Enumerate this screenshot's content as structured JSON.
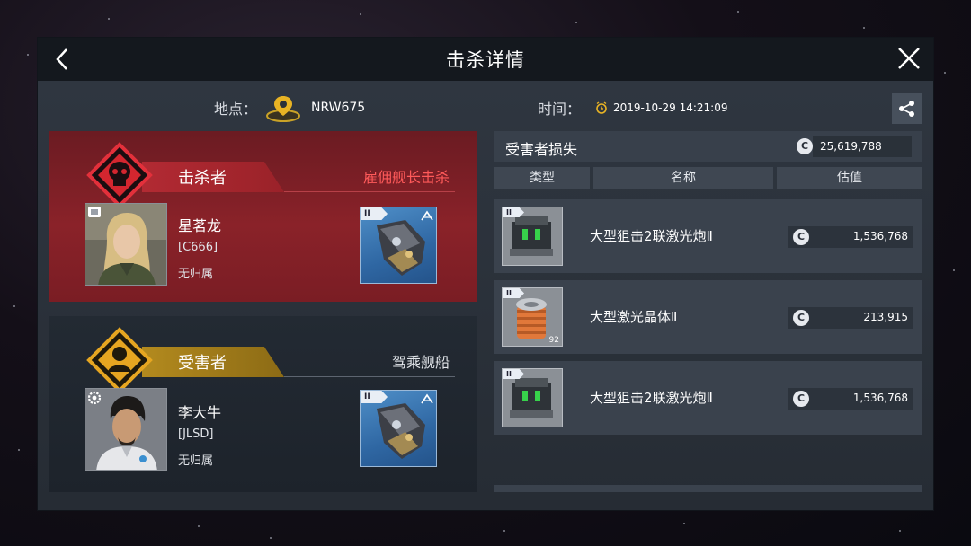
{
  "window": {
    "title": "击杀详情"
  },
  "info": {
    "location_label": "地点：",
    "location_value": "NRW675",
    "time_label": "时间：",
    "time_value": "2019-10-29 14:21:09"
  },
  "killer": {
    "role_label": "击杀者",
    "note": "雇佣舰长击杀",
    "name": "星茗龙",
    "corp": "[C666]",
    "alignment": "无归属",
    "ship_tier": "II"
  },
  "victim": {
    "role_label": "受害者",
    "note": "驾乘舰船",
    "name": "李大牛",
    "corp": "[JLSD]",
    "alignment": "无归属",
    "ship_tier": "II"
  },
  "loss": {
    "title": "受害者损失",
    "total": "25,619,788",
    "currency_symbol": "C",
    "columns": [
      "类型",
      "名称",
      "估值"
    ],
    "items": [
      {
        "tier": "II",
        "name": "大型狙击2联激光炮Ⅱ",
        "value": "1,536,768",
        "icon": "laser-turret-icon",
        "quantity": ""
      },
      {
        "tier": "II",
        "name": "大型激光晶体Ⅱ",
        "value": "213,915",
        "icon": "crystal-ammo-icon",
        "quantity": "92"
      },
      {
        "tier": "II",
        "name": "大型狙击2联激光炮Ⅱ",
        "value": "1,536,768",
        "icon": "laser-turret-icon",
        "quantity": ""
      }
    ]
  },
  "colors": {
    "killer_accent": "#b22a33",
    "victim_accent": "#c8961e",
    "panel_bg": "#2a3039"
  }
}
